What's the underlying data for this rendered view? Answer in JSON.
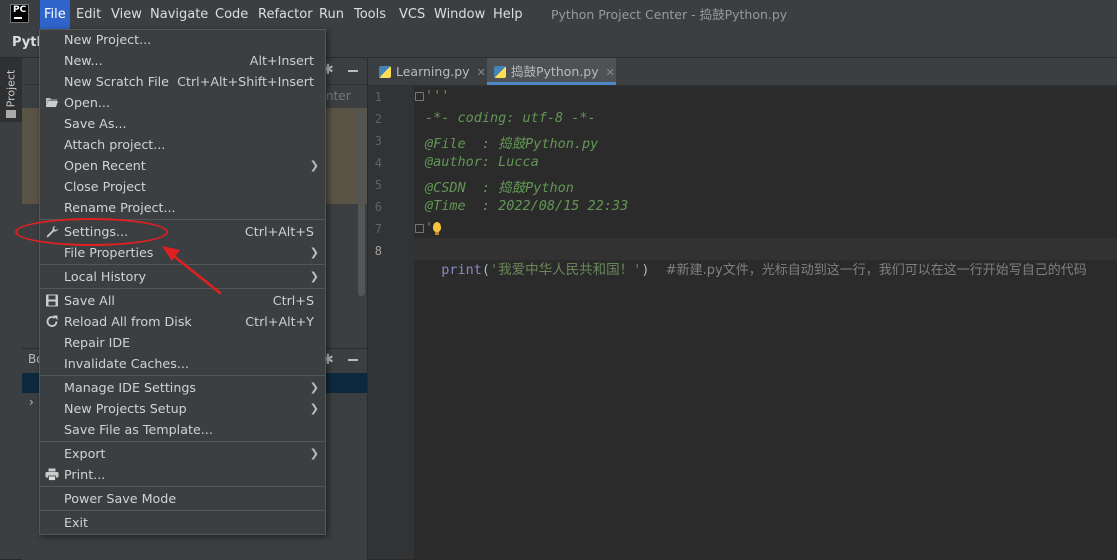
{
  "app": {
    "window_title": "Python Project Center - 捣鼓Python.py",
    "project_short": "Pyth",
    "logo_text": "PC"
  },
  "menubar": [
    {
      "label": "File",
      "active": true
    },
    {
      "label": "Edit"
    },
    {
      "label": "View"
    },
    {
      "label": "Navigate"
    },
    {
      "label": "Code"
    },
    {
      "label": "Refactor"
    },
    {
      "label": "Run"
    },
    {
      "label": "Tools"
    },
    {
      "label": "VCS"
    },
    {
      "label": "Window"
    },
    {
      "label": "Help"
    }
  ],
  "file_menu": {
    "items": [
      {
        "label": "New Project...",
        "shortcut": "",
        "submenu": false,
        "icon": ""
      },
      {
        "label": "New...",
        "shortcut": "Alt+Insert",
        "submenu": false,
        "icon": ""
      },
      {
        "label": "New Scratch File",
        "shortcut": "Ctrl+Alt+Shift+Insert",
        "submenu": false,
        "icon": ""
      },
      {
        "label": "Open...",
        "shortcut": "",
        "submenu": false,
        "icon": "folder-icon"
      },
      {
        "label": "Save As...",
        "shortcut": "",
        "submenu": false,
        "icon": ""
      },
      {
        "label": "Attach project...",
        "shortcut": "",
        "submenu": false,
        "icon": ""
      },
      {
        "label": "Open Recent",
        "shortcut": "",
        "submenu": true,
        "icon": ""
      },
      {
        "label": "Close Project",
        "shortcut": "",
        "submenu": false,
        "icon": ""
      },
      {
        "label": "Rename Project...",
        "shortcut": "",
        "submenu": false,
        "icon": ""
      },
      {
        "label": "Settings...",
        "shortcut": "Ctrl+Alt+S",
        "submenu": false,
        "icon": "wrench-icon"
      },
      {
        "label": "File Properties",
        "shortcut": "",
        "submenu": true,
        "icon": ""
      },
      {
        "label": "Local History",
        "shortcut": "",
        "submenu": true,
        "icon": ""
      },
      {
        "label": "Save All",
        "shortcut": "Ctrl+S",
        "submenu": false,
        "icon": "save-icon"
      },
      {
        "label": "Reload All from Disk",
        "shortcut": "Ctrl+Alt+Y",
        "submenu": false,
        "icon": "reload-icon"
      },
      {
        "label": "Repair IDE",
        "shortcut": "",
        "submenu": false,
        "icon": ""
      },
      {
        "label": "Invalidate Caches...",
        "shortcut": "",
        "submenu": false,
        "icon": ""
      },
      {
        "label": "Manage IDE Settings",
        "shortcut": "",
        "submenu": true,
        "icon": ""
      },
      {
        "label": "New Projects Setup",
        "shortcut": "",
        "submenu": true,
        "icon": ""
      },
      {
        "label": "Save File as Template...",
        "shortcut": "",
        "submenu": false,
        "icon": ""
      },
      {
        "label": "Export",
        "shortcut": "",
        "submenu": true,
        "icon": ""
      },
      {
        "label": "Print...",
        "shortcut": "",
        "submenu": false,
        "icon": "print-icon"
      },
      {
        "label": "Power Save Mode",
        "shortcut": "",
        "submenu": false,
        "icon": ""
      },
      {
        "label": "Exit",
        "shortcut": "",
        "submenu": false,
        "icon": ""
      }
    ]
  },
  "sidebar": {
    "project_tab": "Project",
    "hint_text": "nter",
    "bottom_panel_label": "Bo"
  },
  "editor": {
    "tabs": [
      {
        "label": "Learning.py",
        "active": false
      },
      {
        "label": "捣鼓Python.py",
        "active": true
      }
    ],
    "lines": [
      {
        "num": "1",
        "text": "'''"
      },
      {
        "num": "2",
        "text": "-*- coding: utf-8 -*-"
      },
      {
        "num": "3",
        "text": "@File  : 捣鼓Python.py"
      },
      {
        "num": "4",
        "text": "@author: Lucca"
      },
      {
        "num": "5",
        "text": "@CSDN  : 捣鼓Python"
      },
      {
        "num": "6",
        "text": "@Time  : 2022/08/15 22:33"
      },
      {
        "num": "7",
        "text": "'"
      },
      {
        "num": "8",
        "text": ""
      }
    ],
    "code_line8": {
      "func": "print",
      "open": "(",
      "string": "'我爱中华人民共和国！'",
      "close": ")",
      "comment": "#新建.py文件，光标自动到这一行，我们可以在这一行开始写自己的代码"
    }
  },
  "colors": {
    "menu_active": "#2f65ca",
    "annotation": "#e02020",
    "docstring": "#629755",
    "string": "#6a8759",
    "keyword": "#8888c6"
  }
}
